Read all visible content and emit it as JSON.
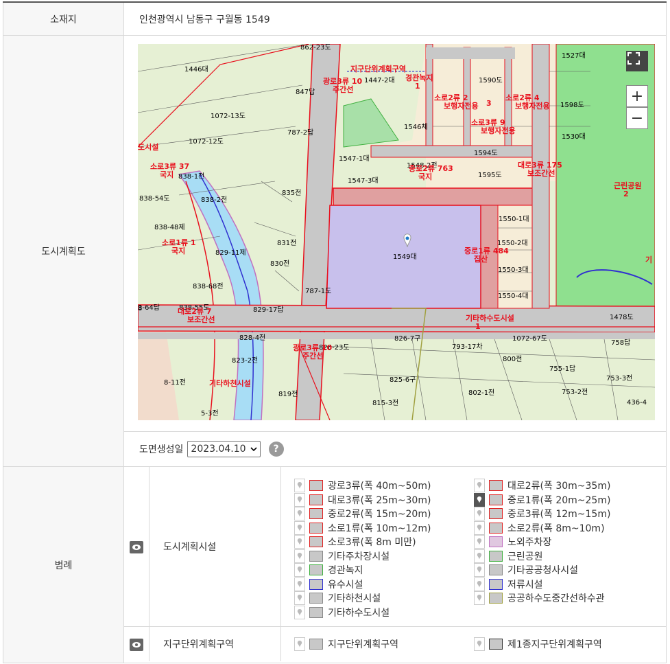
{
  "location": {
    "label": "소재지",
    "value": "인천광역시 남동구 구월동 1549"
  },
  "plan": {
    "label": "도시계획도"
  },
  "map": {
    "lots": [
      "862-23도",
      "1446대",
      "1447-2대",
      "1590도",
      "1527대",
      "1072-13도",
      "787-2답",
      "1546체",
      "1598도",
      "1072-12도",
      "1530대",
      "1594도",
      "1547-1대",
      "1595도",
      "838-1전",
      "1547-3대",
      "1548-2전",
      "838-54도",
      "838-2전",
      "835전",
      "838-48제",
      "831전",
      "1550-1대",
      "1550-2대",
      "829-11제",
      "830전",
      "1549대",
      "1550-3대",
      "838-68전",
      "787-1도",
      "1550-4대",
      "3-64답",
      "838-55도",
      "829-17답",
      "1478도",
      "828-4전",
      "826-7구",
      "1072-67도",
      "758답",
      "823-2전",
      "826-23도",
      "793-17차",
      "800전",
      "755-1답",
      "8-11전",
      "825-6구",
      "753-3전",
      "819전",
      "802-1전",
      "753-2전",
      "815-3전",
      "436-4",
      "5-3전",
      "847답",
      "8"
    ],
    "zones": [
      "지구단위계획구역",
      "경관녹지\n1",
      "광로3류 10\n주간선",
      "소로2류 2\n보행자전용",
      "3",
      "소로2류 4\n보행자전용",
      "소로3류 9\n보행자전용",
      "도시설",
      "소로3류 37\n국지",
      "중로2류 763\n국지",
      "대로3류 175\n보조간선",
      "근린공원\n2",
      "소로1류 1\n국지",
      "중로1류 484\n집산",
      "대로2류 7\n보조간선",
      "기타하수도시설\n1",
      "광로3류 10\n주간선",
      "기타하천시설",
      "기"
    ],
    "zoom_in": "+",
    "zoom_out": "−"
  },
  "date": {
    "label": "도면생성일",
    "value": "2023.04.10",
    "help": "?"
  },
  "legend": {
    "label": "범례",
    "groups": [
      {
        "name": "도시계획시설",
        "items": [
          {
            "text": "광로3류(폭 40m~50m)",
            "fill": "#c8c8c8",
            "border": "#e02020"
          },
          {
            "text": "대로2류(폭 30m~35m)",
            "fill": "#c8c8c8",
            "border": "#e02020"
          },
          {
            "text": "대로3류(폭 25m~30m)",
            "fill": "#c8c8c8",
            "border": "#e02020"
          },
          {
            "text": "중로1류(폭 20m~25m)",
            "fill": "#c8c8c8",
            "border": "#e02020",
            "active": true
          },
          {
            "text": "중로2류(폭 15m~20m)",
            "fill": "#c8c8c8",
            "border": "#e02020"
          },
          {
            "text": "중로3류(폭 12m~15m)",
            "fill": "#c8c8c8",
            "border": "#e02020"
          },
          {
            "text": "소로1류(폭 10m~12m)",
            "fill": "#c8c8c8",
            "border": "#e02020"
          },
          {
            "text": "소로2류(폭 8m~10m)",
            "fill": "#c8c8c8",
            "border": "#e02020"
          },
          {
            "text": "소로3류(폭 8m 미만)",
            "fill": "#c8c8c8",
            "border": "#e02020"
          },
          {
            "text": "노외주차장",
            "fill": "#e0c8e0",
            "border": "#c070c0"
          },
          {
            "text": "기타주차장시설",
            "fill": "#c8c8c8",
            "border": "#888888"
          },
          {
            "text": "근린공원",
            "fill": "#c8c8c8",
            "border": "#40b040"
          },
          {
            "text": "경관녹지",
            "fill": "#c8c8c8",
            "border": "#40b040"
          },
          {
            "text": "기타공공청사시설",
            "fill": "#c8c8c8",
            "border": "#888888"
          },
          {
            "text": "유수시설",
            "fill": "#c8c8c8",
            "border": "#3030d0"
          },
          {
            "text": "저류시설",
            "fill": "#c8c8c8",
            "border": "#3030d0"
          },
          {
            "text": "기타하천시설",
            "fill": "#c8c8c8",
            "border": "#888888"
          },
          {
            "text": "공공하수도중간선하수관",
            "fill": "#c8c8c8",
            "border": "#a0a040"
          },
          {
            "text": "기타하수도시설",
            "fill": "#c8c8c8",
            "border": "#888888"
          }
        ]
      },
      {
        "name": "지구단위계획구역",
        "items": [
          {
            "text": "지구단위계획구역",
            "fill": "#c8c8c8",
            "border": "#888888"
          },
          {
            "text": "제1종지구단위계획구역",
            "fill": "#c8c8c8",
            "border": "#333333"
          }
        ]
      }
    ]
  }
}
